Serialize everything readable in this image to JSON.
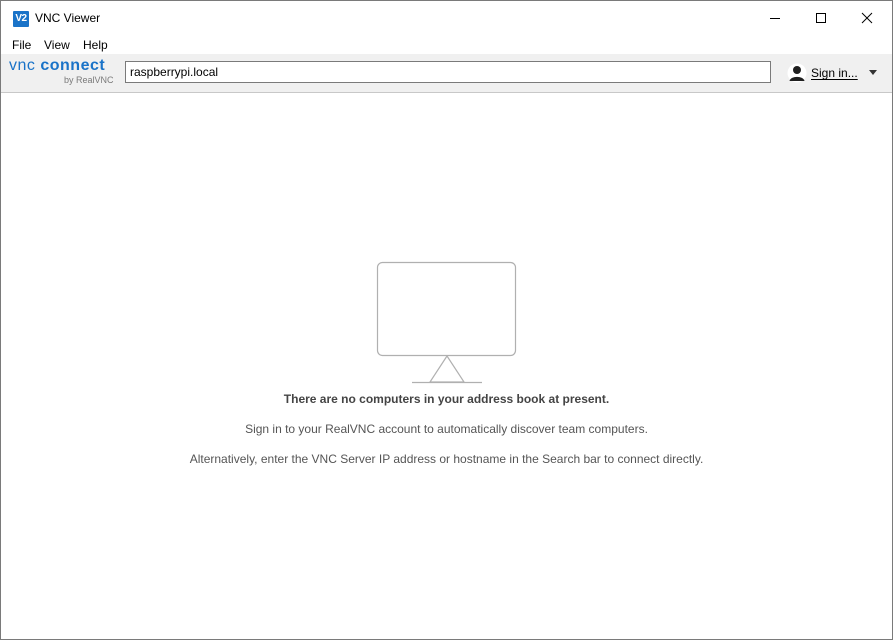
{
  "window": {
    "title": "VNC Viewer",
    "app_icon_text": "V2",
    "controls": [
      "minimize",
      "maximize",
      "close"
    ]
  },
  "menu": {
    "items": [
      "File",
      "View",
      "Help"
    ]
  },
  "toolbar": {
    "logo_vnc": "vnc",
    "logo_connect": "connect",
    "logo_by": "by RealVNC",
    "search_value": "raspberrypi.local",
    "signin_label": "Sign in..."
  },
  "empty_state": {
    "heading": "There are no computers in your address book at present.",
    "line1": "Sign in to your RealVNC account to automatically discover team computers.",
    "line2": "Alternatively, enter the VNC Server IP address or hostname in the Search bar to connect directly."
  },
  "colors": {
    "brand_blue": "#1a73c8",
    "toolbar_bg": "#f0f0f0",
    "monitor_stroke": "#b0b0b0"
  }
}
